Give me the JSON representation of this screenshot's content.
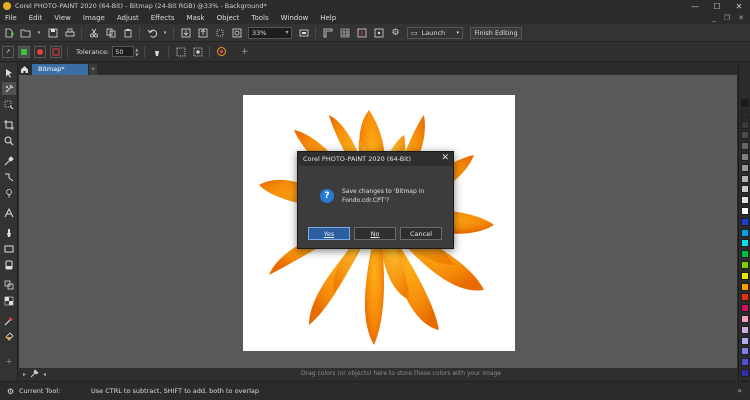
{
  "window": {
    "title": "Corel PHOTO-PAINT 2020 (64-Bit) - Bitmap (24-Bit RGB) @33% - Background*",
    "minimize": "—",
    "maximize": "☐",
    "close": "✕"
  },
  "menu": {
    "items": [
      "File",
      "Edit",
      "View",
      "Image",
      "Adjust",
      "Effects",
      "Mask",
      "Object",
      "Tools",
      "Window",
      "Help"
    ],
    "right_min": "_",
    "right_restore": "❐",
    "right_close": "✕"
  },
  "toolbar": {
    "zoom_value": "33%",
    "launch_label": "Launch",
    "finish_label": "Finish Editing"
  },
  "property_bar": {
    "tolerance_label": "Tolerance:",
    "tolerance_value": "50"
  },
  "document": {
    "tab_label": "Bitmap*",
    "tab_add": "+"
  },
  "dialog": {
    "title": "Corel PHOTO-PAINT 2020 (64-Bit)",
    "close": "✕",
    "icon": "?",
    "message": "Save changes to 'Bitmap in Fondo.cdr.CPT'?",
    "buttons": {
      "yes": "Yes",
      "no": "No",
      "cancel": "Cancel"
    }
  },
  "canvas": {
    "hint": "Drag colors (or objects) here to store these colors with your image"
  },
  "status": {
    "label": "Current Tool:",
    "message": "Use CTRL to subtract, SHIFT to add, both to overlap",
    "right_icon": "»"
  },
  "colors": {
    "palette": [
      "#1a1a1a",
      "#2a2a2a",
      "#3a3a3a",
      "#4d4d4d",
      "#666666",
      "#808080",
      "#999999",
      "#b3b3b3",
      "#cccccc",
      "#e6e6e6",
      "#ffffff",
      "#1a3fd9",
      "#00a3e8",
      "#00e5ee",
      "#00c040",
      "#7ad100",
      "#e8e800",
      "#f5a000",
      "#e83010",
      "#d01060",
      "#f0a0c0",
      "#c8b0e0",
      "#b0b0f0",
      "#8080e8",
      "#5050d0",
      "#3030b0",
      "#202090",
      "#101060"
    ]
  }
}
